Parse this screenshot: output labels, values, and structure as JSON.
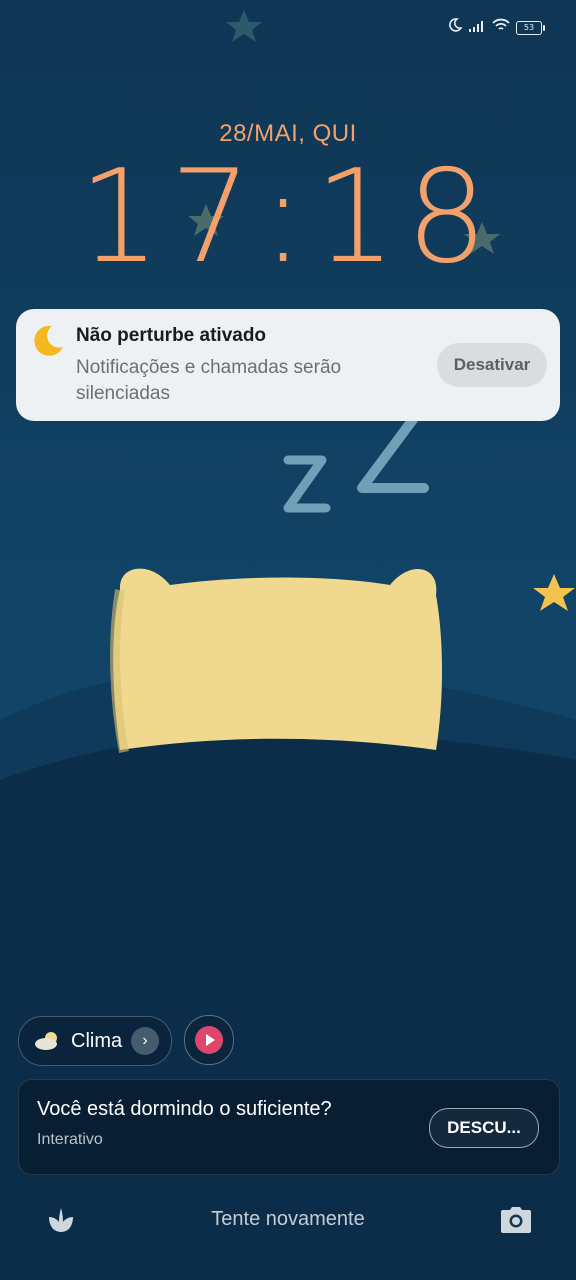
{
  "status_bar": {
    "icons": [
      "moon-icon",
      "signal-icon",
      "wifi-icon",
      "battery-icon"
    ],
    "battery": "53"
  },
  "lockscreen": {
    "date": "28/MAI, QUI",
    "time": "17:18"
  },
  "notification": {
    "icon": "moon-icon",
    "title": "Não perturbe ativado",
    "body": "Notificações e chamadas serão silenciadas",
    "button_label": "Desativar"
  },
  "widgets": {
    "weather_chip_label": "Clima",
    "weather_icon": "cloud-sun-icon",
    "media_icon": "play-icon"
  },
  "suggestion_card": {
    "title": "Você está dormindo o suficiente?",
    "subtitle": "Interativo",
    "button_label": "DESCU..."
  },
  "bottom_bar": {
    "left_icon": "flower-icon",
    "hint": "Tente novamente",
    "right_icon": "camera-icon"
  },
  "colors": {
    "accent": "#f4a06a",
    "background": "#114366",
    "pillow": "#f0d98e",
    "zz": "#6fa0b8",
    "star": "#f2c34e"
  }
}
